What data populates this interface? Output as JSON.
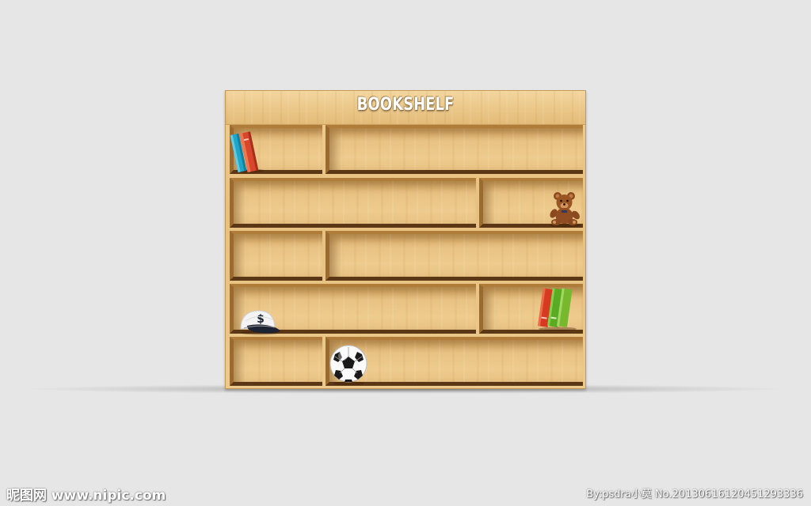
{
  "bookshelf": {
    "title": "BOOKSHELF"
  },
  "icons": {
    "books_top": "books-icon",
    "teddy": "teddy-bear-icon",
    "cap": "baseball-cap-icon",
    "books_right": "books-icon",
    "ball": "soccer-ball-icon"
  },
  "colors": {
    "background": "#e6e6e6",
    "wood": "#ecc98b",
    "shelf_shadow": "#5c3715"
  },
  "watermark": {
    "left": "昵图网 www.nipic.com",
    "right": "By:psdra小莫 No.20130616120451293336"
  }
}
